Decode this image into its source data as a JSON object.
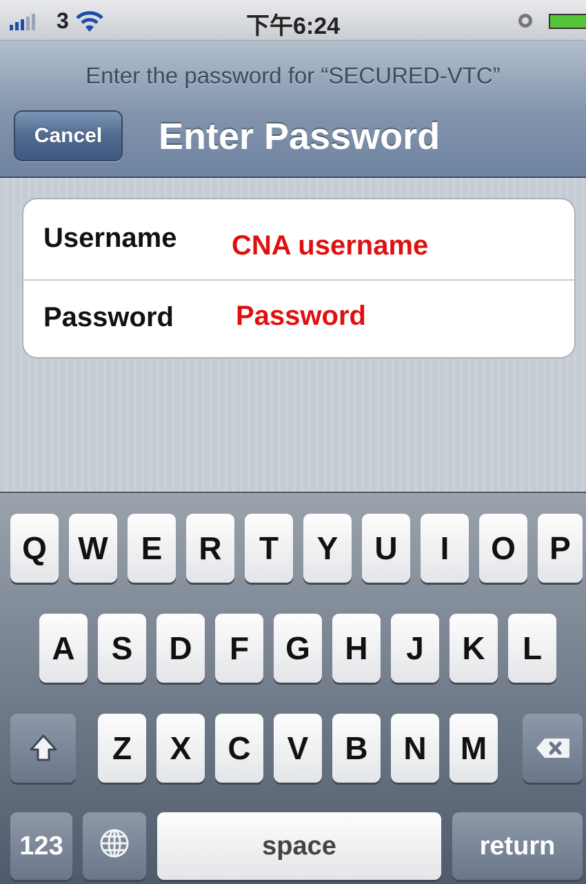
{
  "status_bar": {
    "carrier": "3",
    "time": "下午6:24"
  },
  "nav": {
    "prompt": "Enter the password for “SECURED-VTC”",
    "cancel_label": "Cancel",
    "title": "Enter Password"
  },
  "form": {
    "username_label": "Username",
    "username_value": "CNA username",
    "password_label": "Password",
    "password_value": "Password"
  },
  "keyboard": {
    "row1": [
      "Q",
      "W",
      "E",
      "R",
      "T",
      "Y",
      "U",
      "I",
      "O",
      "P"
    ],
    "row2": [
      "A",
      "S",
      "D",
      "F",
      "G",
      "H",
      "J",
      "K",
      "L"
    ],
    "row3": [
      "Z",
      "X",
      "C",
      "V",
      "B",
      "N",
      "M"
    ],
    "numbers_label": "123",
    "space_label": "space",
    "return_label": "return",
    "shift_icon": "shift-arrow-icon",
    "delete_icon": "delete-backspace-icon",
    "globe_icon": "globe-icon"
  },
  "colors": {
    "annotation_red": "#e01010",
    "nav_blue": "#6e83a0"
  }
}
